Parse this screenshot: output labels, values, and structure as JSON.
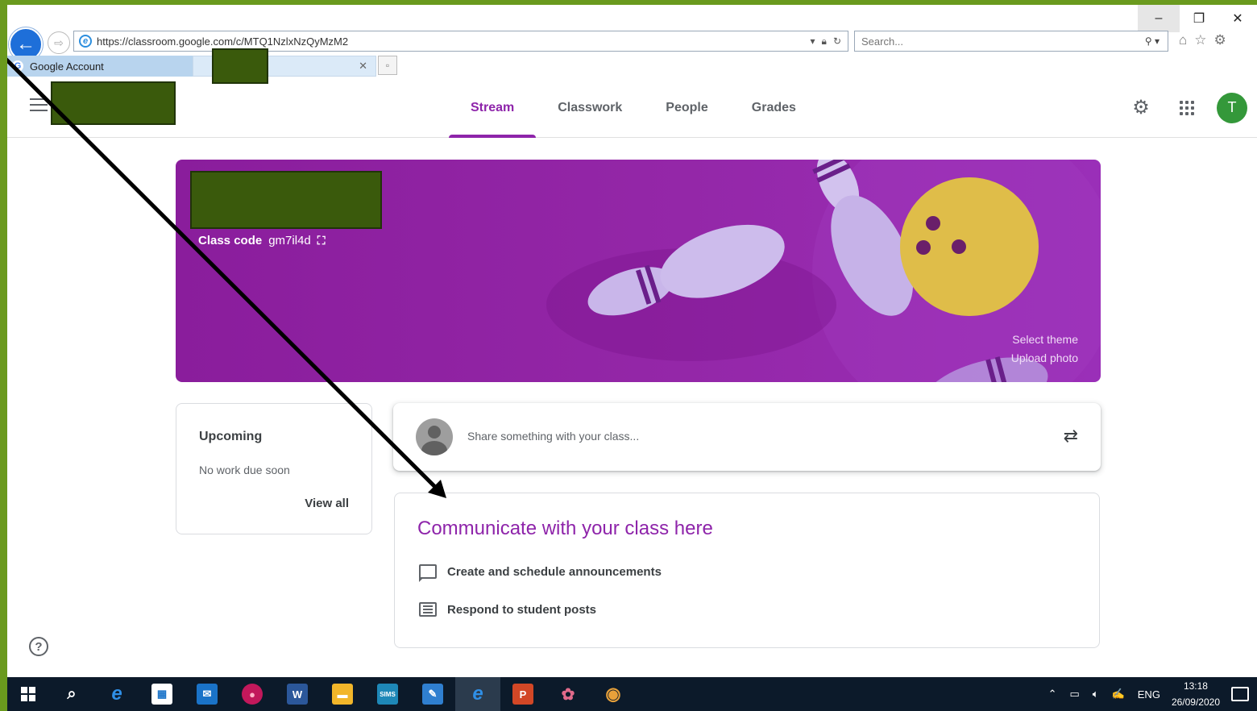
{
  "browser": {
    "url": "https://classroom.google.com/c/MTQ1NzlxNzQyMzM2",
    "search_placeholder": "Search...",
    "tabs": [
      {
        "label": "Google Account"
      },
      {
        "label": ""
      }
    ],
    "window_controls": {
      "minimize": "–",
      "restore": "❐",
      "close": "✕"
    }
  },
  "classroom": {
    "nav": {
      "tabs": [
        "Stream",
        "Classwork",
        "People",
        "Grades"
      ],
      "active": "Stream"
    },
    "avatar_letter": "T",
    "banner": {
      "class_code_label": "Class code",
      "class_code": "gm7il4d",
      "select_theme": "Select theme",
      "upload_photo": "Upload photo"
    },
    "upcoming": {
      "title": "Upcoming",
      "subtitle": "No work due soon",
      "link": "View all"
    },
    "share": {
      "placeholder": "Share something with your class..."
    },
    "communicate": {
      "title": "Communicate with your class here",
      "items": [
        {
          "label": "Create and schedule announcements",
          "icon": "chat-bubble-icon"
        },
        {
          "label": "Respond to student posts",
          "icon": "posts-icon"
        }
      ]
    }
  },
  "taskbar": {
    "language": "ENG",
    "time": "13:18",
    "date": "26/09/2020",
    "apps": [
      {
        "name": "search-icon",
        "glyph": "⌕",
        "color": "transparent"
      },
      {
        "name": "edge-icon",
        "glyph": "e",
        "color": "transparent"
      },
      {
        "name": "store-icon",
        "glyph": "▦",
        "color": "#ffffff"
      },
      {
        "name": "mail-icon",
        "glyph": "✉",
        "color": "#1a73c8"
      },
      {
        "name": "app-red-icon",
        "glyph": "●",
        "color": "#c2185b"
      },
      {
        "name": "word-icon",
        "glyph": "W",
        "color": "#2b579a"
      },
      {
        "name": "explorer-icon",
        "glyph": "▬",
        "color": "#f2b62a"
      },
      {
        "name": "sims-icon",
        "glyph": "SIMS",
        "color": "#1e88b8"
      },
      {
        "name": "notes-icon",
        "glyph": "✎",
        "color": "#2f7fd0"
      },
      {
        "name": "ie-icon",
        "glyph": "e",
        "color": "transparent"
      },
      {
        "name": "powerpoint-icon",
        "glyph": "P",
        "color": "#d24726"
      },
      {
        "name": "paint-icon",
        "glyph": "✿",
        "color": "transparent"
      },
      {
        "name": "chrome-icon",
        "glyph": "◉",
        "color": "transparent"
      }
    ]
  },
  "colors": {
    "accent": "#8e24aa",
    "banner": "#9427a8",
    "redaction": "#3a5a0c",
    "frame_border": "#6a9a1e",
    "taskbar": "#0c1a2a"
  }
}
